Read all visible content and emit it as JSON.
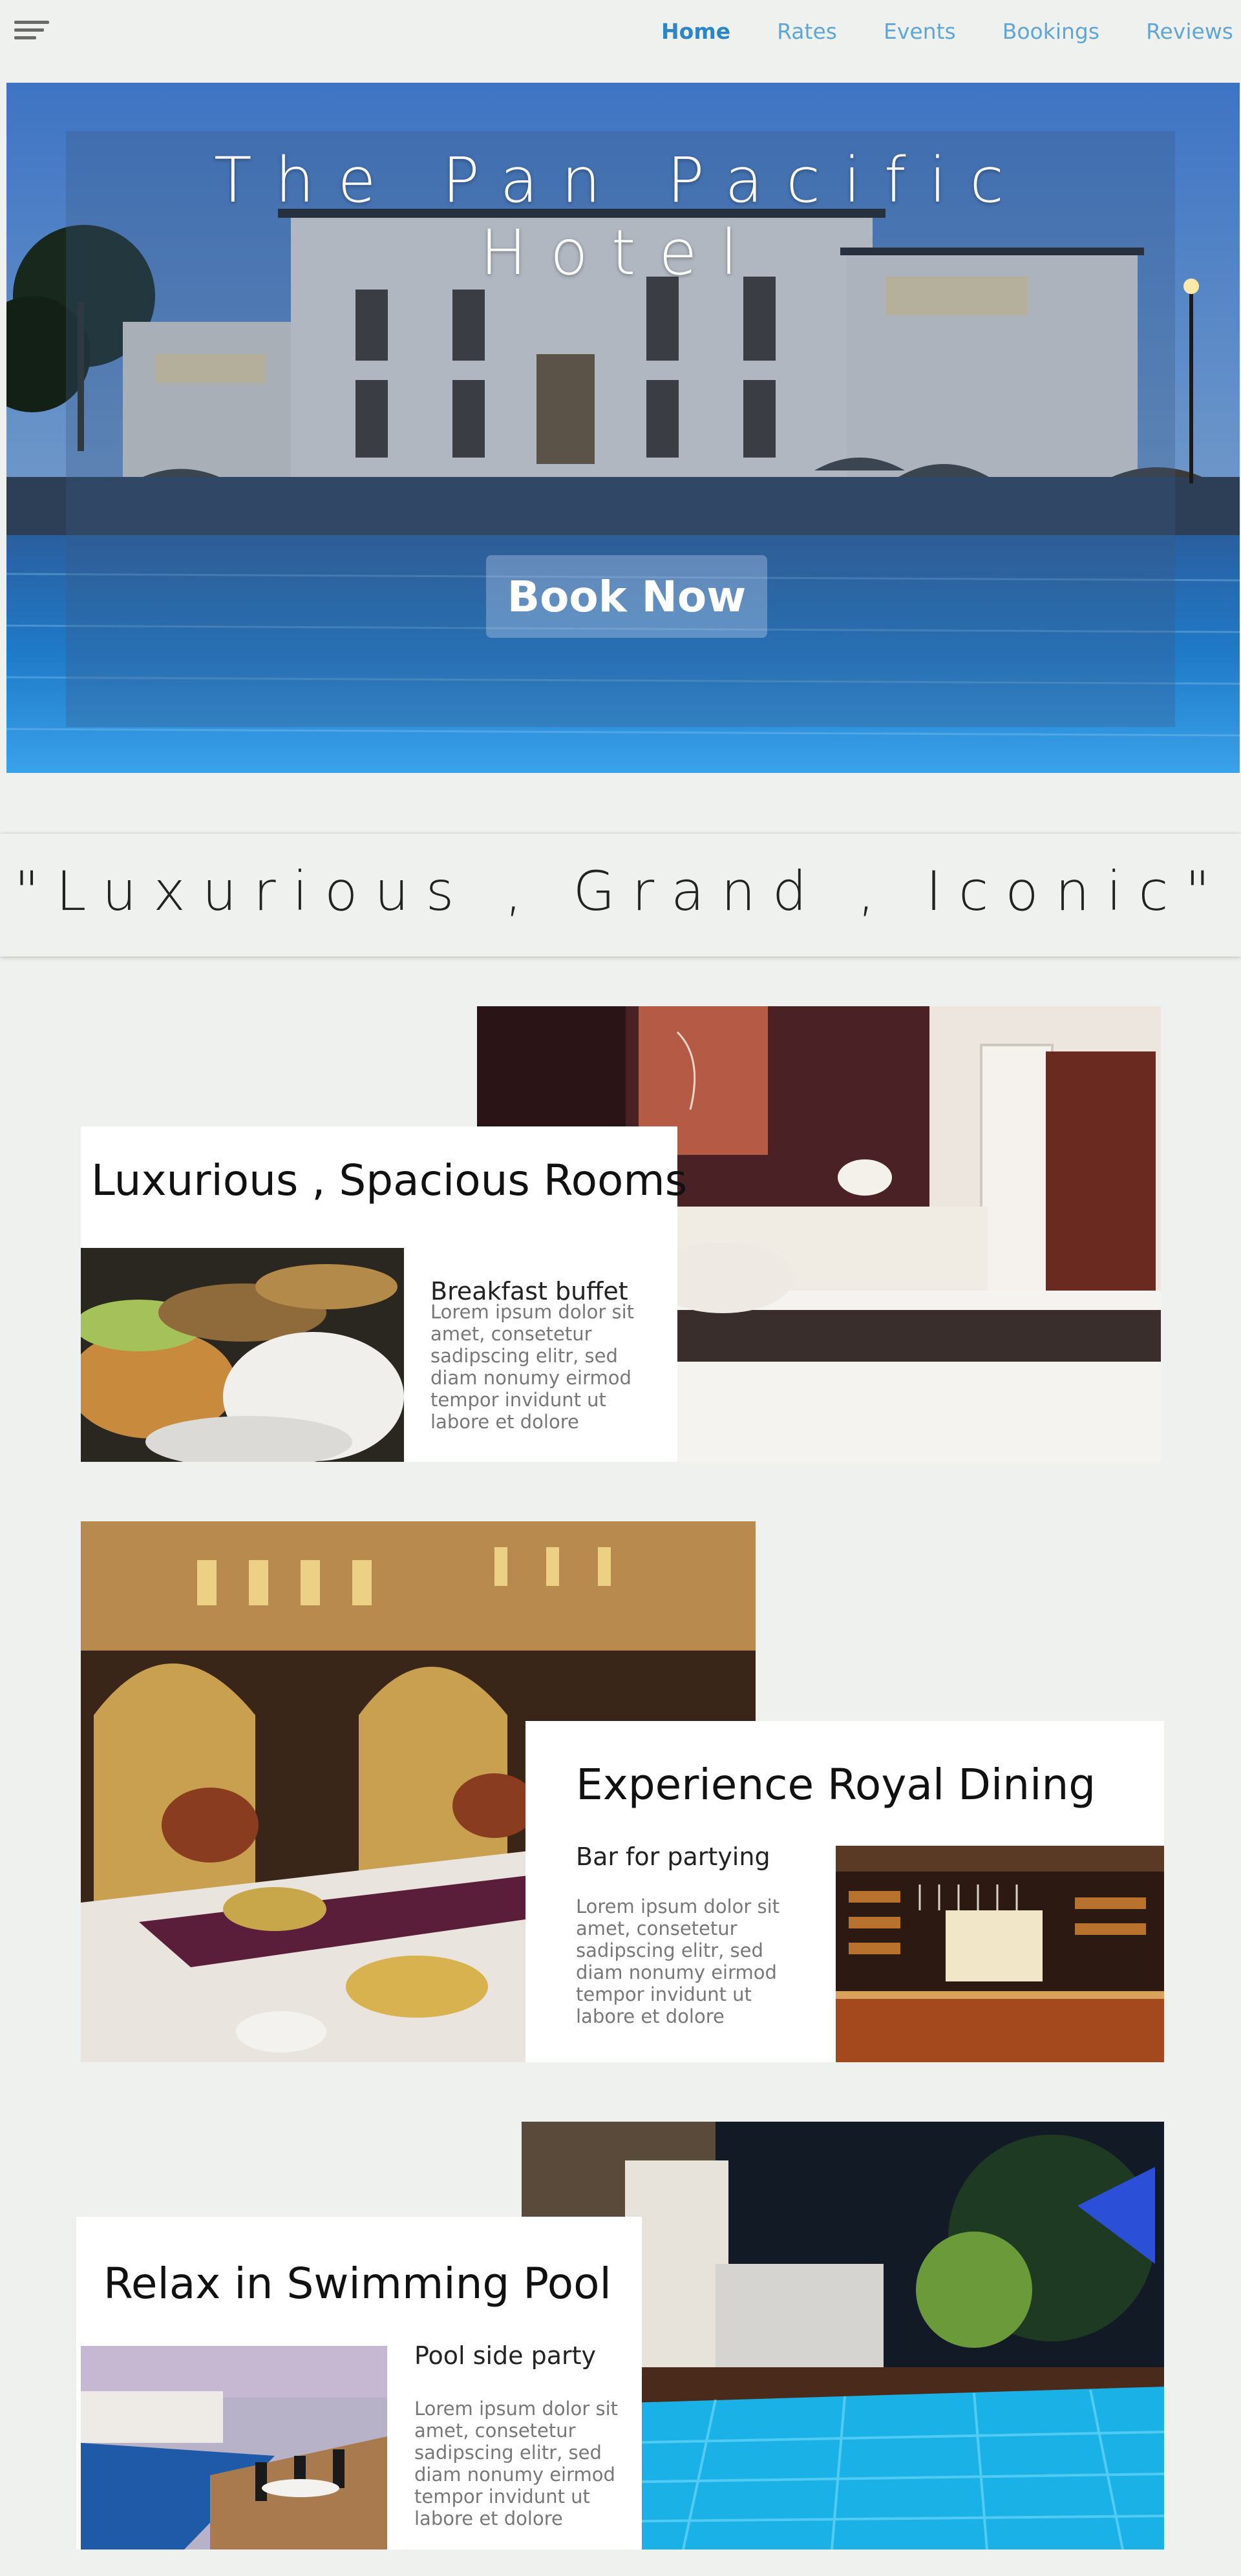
{
  "nav": {
    "links": [
      "Home",
      "Rates",
      "Events",
      "Bookings",
      "Reviews"
    ],
    "active": "Home"
  },
  "hero": {
    "title": "The Pan Pacific Hotel",
    "button": "Book Now"
  },
  "tagline": "\"Luxurious , Grand , Iconic\"",
  "sections": [
    {
      "title": "Luxurious , Spacious Rooms",
      "subtitle": "Breakfast buffet",
      "body_lines": [
        "Lorem ipsum dolor sit",
        "amet, consetetur",
        "sadipscing elitr, sed",
        "diam nonumy eirmod",
        "tempor invidunt ut",
        "labore et dolore"
      ]
    },
    {
      "title": "Experience Royal Dining",
      "subtitle": "Bar for partying",
      "body_lines": [
        "Lorem ipsum dolor sit",
        "amet, consetetur",
        "sadipscing elitr, sed",
        "diam nonumy eirmod",
        "tempor invidunt ut",
        "labore et dolore"
      ]
    },
    {
      "title": "Relax in Swimming Pool",
      "subtitle": "Pool side party",
      "body_lines": [
        "Lorem ipsum dolor sit",
        "amet, consetetur",
        "sadipscing elitr, sed",
        "diam nonumy eirmod",
        "tempor invidunt ut",
        "labore et dolore"
      ]
    }
  ],
  "colors": {
    "background": "#eff1ee",
    "nav_link": "#5fa6d6",
    "nav_active": "#2c86c6",
    "card": "#ffffff"
  }
}
